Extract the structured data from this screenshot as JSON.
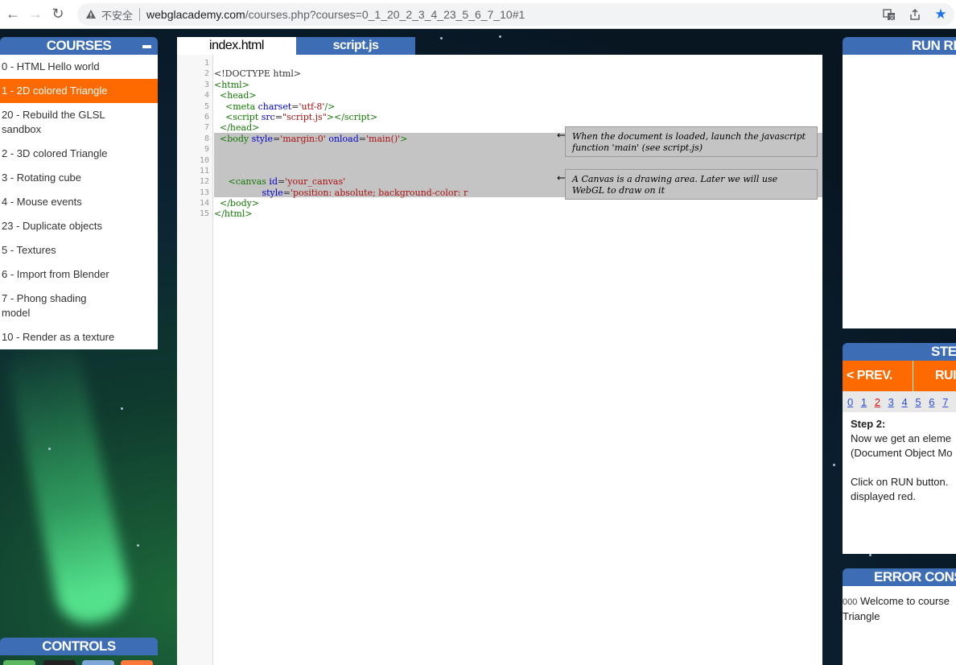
{
  "browser": {
    "insecure_label": "不安全",
    "url_host": "webglacademy.com",
    "url_rest": "/courses.php?courses=0_1_20_2_3_4_23_5_6_7_10#1"
  },
  "courses": {
    "title": "COURSES",
    "items": [
      "0 - HTML Hello world",
      "1 - 2D colored Triangle",
      "20 - Rebuild the GLSL sandbox",
      "2 - 3D colored Triangle",
      "3 - Rotating cube",
      "4 - Mouse events",
      "23 - Duplicate objects",
      "5 - Textures",
      "6 - Import from Blender",
      "7 - Phong shading model",
      "10 - Render as a texture"
    ],
    "active_index": 1
  },
  "controls": {
    "title": "CONTROLS",
    "swatch_colors": [
      "#5cb85c",
      "#222222",
      "#7fa7d8",
      "#ff7a3a"
    ]
  },
  "editor": {
    "tabs": [
      "index.html",
      "script.js"
    ],
    "active_tab": "index.html",
    "line_numbers": [
      "1",
      "2",
      "3",
      "4",
      "5",
      "6",
      "7",
      "8",
      "9",
      "10",
      "11",
      "12",
      "13",
      "14",
      "15"
    ],
    "notes": [
      "When the document is loaded, launch the javascript function 'main' (see script.js)",
      "A Canvas is a drawing area. Later we will use WebGL to draw on it"
    ]
  },
  "run_panel": {
    "title": "RUN RE"
  },
  "steps": {
    "title": "STEI",
    "prev_label": "< PREV.",
    "run_label": "RUI",
    "numbers": [
      "0",
      "1",
      "2",
      "3",
      "4",
      "5",
      "6",
      "7"
    ],
    "current": "2",
    "body_title": "Step 2:",
    "body_lines": [
      "Now we get an eleme",
      "(Document Object Mo",
      "",
      "Click on RUN button.",
      "displayed red."
    ]
  },
  "error_console": {
    "title": "ERROR CONSO",
    "code": "000",
    "message_line1": "Welcome to course",
    "message_line2": "Triangle"
  }
}
